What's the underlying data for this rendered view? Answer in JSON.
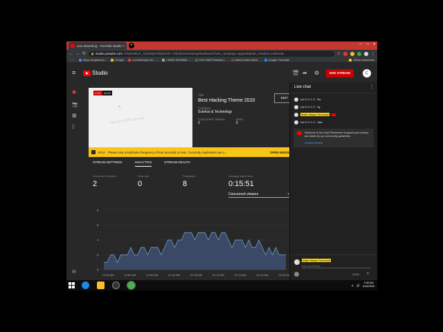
{
  "browser": {
    "tab_title": "Live streaming - YouTube Studio",
    "tab_close": "×",
    "new_tab": "+",
    "window_controls": [
      "—",
      "□",
      "✕"
    ],
    "url_host": "studio.youtube.com",
    "url_path": "/channel/UC_Xd1aRtpATBqGtztR~72bs/livestreaming/dashboard?utm_campaign=upgrade&utm_medium=redirect&...",
    "bookmarks": [
      {
        "label": "https://drgames.b...",
        "color": "#4285f4"
      },
      {
        "label": "Google",
        "color": "#fbbc05"
      },
      {
        "label": "convert2mp3.net - ...",
        "color": "#e53935"
      },
      {
        "label": "« BISE SAHIWAL ...",
        "color": "#9e9e9e"
      },
      {
        "label": "Free SMS Pakistan |...",
        "color": "#2e7d32"
      },
      {
        "label": "Watch Indian Movi...",
        "color": "#6d4c41"
      },
      {
        "label": "Google Translate",
        "color": "#1e88e5"
      }
    ],
    "other_bookmarks": "Other bookmarks"
  },
  "header": {
    "logo_text": "Studio",
    "end_stream": "END STREAM",
    "avatar_letter": "C"
  },
  "stream": {
    "live_label": "LIVE",
    "elapsed": "44:49",
    "preview_text": "Tap you 100% tap your ...",
    "title_label": "Title",
    "title": "Best Hacking Theme 2020",
    "category_label": "Category",
    "category": "Science & Technology",
    "viewers_label": "Concurrent viewers",
    "viewers": "2",
    "likes_label": "Likes",
    "likes": "3",
    "edit": "EDIT"
  },
  "error": {
    "icon": "!",
    "label": "Error",
    "message": "Please use a keyframe frequency of four seconds or less. Currently, keyframes are n...",
    "action": "OPEN WIDGET"
  },
  "tabs": [
    "STREAM SETTINGS",
    "ANALYTICS",
    "STREAM HEALTH"
  ],
  "stats": {
    "viewers_label": "Concurrent viewers",
    "viewers": "2",
    "chat_label": "Chat rate",
    "chat": "0",
    "playbacks_label": "Playbacks",
    "playbacks": "8",
    "watch_label": "Average watch time",
    "watch": "0:15:51",
    "metric": "Concurrent viewers"
  },
  "chart_data": {
    "type": "area",
    "ylim": [
      0,
      8
    ],
    "yticks": [
      0,
      2,
      4,
      6,
      8
    ],
    "xticks": [
      "12:45 AM",
      "12:50 AM",
      "12:55 AM",
      "01:00 AM",
      "01:05 AM",
      "01:10 AM",
      "01:15 AM",
      "01:20 AM",
      "01:25 AM"
    ],
    "values": [
      1,
      1,
      2,
      2,
      1,
      2,
      2,
      2,
      3,
      2,
      2,
      3,
      3,
      2,
      3,
      3,
      3,
      2,
      3,
      4,
      4,
      3,
      4,
      4,
      5,
      5,
      5,
      4,
      5,
      5,
      5,
      4,
      5,
      5,
      4,
      5,
      5,
      4,
      3,
      4,
      4,
      4,
      3,
      4,
      3,
      3,
      4,
      3,
      2,
      3,
      2,
      3,
      2,
      2,
      2
    ],
    "fill_color": "#3a4a66",
    "line_color": "#7fa6d8"
  },
  "chat": {
    "title": "Live chat",
    "messages": [
      {
        "author": "kali B.S.C.S",
        "text": "No",
        "owner": false
      },
      {
        "author": "kali B.S.C.S",
        "text": "hy",
        "owner": false
      },
      {
        "author": "Malik Waqar Technical",
        "text": "",
        "owner": true
      },
      {
        "author": "kali B.S.C.S",
        "text": "nice",
        "owner": false
      }
    ],
    "welcome": "Welcome to live chat! Remember to guard your privacy and abide by our community guidelines.",
    "learn_more": "LEARN MORE",
    "input_name": "Malik Waqar Technical",
    "input_placeholder": "Say something...",
    "count": "0/200",
    "send": "➤"
  },
  "taskbar": {
    "time": "4:36 AM",
    "date": "6/18/2020",
    "tray": [
      "▲",
      "🔊"
    ]
  }
}
